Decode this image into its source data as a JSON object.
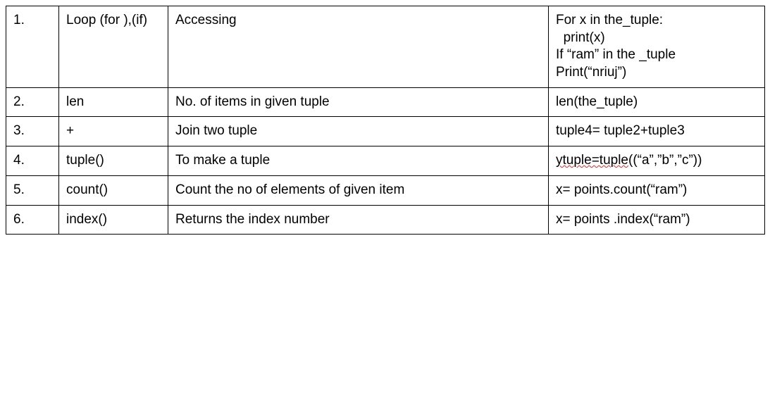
{
  "table": {
    "rows": [
      {
        "num": "1.",
        "func": "Loop (for ),(if)",
        "desc": "Accessing",
        "example_lines": [
          "For x in the_tuple:",
          "  print(x)",
          "If “ram” in the _tuple",
          "Print(“nriuj”)"
        ]
      },
      {
        "num": "2.",
        "func": "len",
        "desc": "No. of items in given tuple",
        "example": "len(the_tuple)"
      },
      {
        "num": "3.",
        "func": "+",
        "desc": "Join two tuple",
        "example": "tuple4= tuple2+tuple3"
      },
      {
        "num": "4.",
        "func": "tuple()",
        "desc": "To make a tuple",
        "example_parts": {
          "pre": "",
          "spell": "ytuple=tuple",
          "post": "((“a”,”b”,”c”))"
        }
      },
      {
        "num": "5.",
        "func": "count()",
        "desc": "Count the no of elements of given item",
        "example_lines": [
          "x= points.count(“ram”)"
        ]
      },
      {
        "num": "6.",
        "func": "index()",
        "desc": "Returns the index number",
        "example_lines": [
          "x= points .index(“ram”)"
        ]
      }
    ]
  }
}
